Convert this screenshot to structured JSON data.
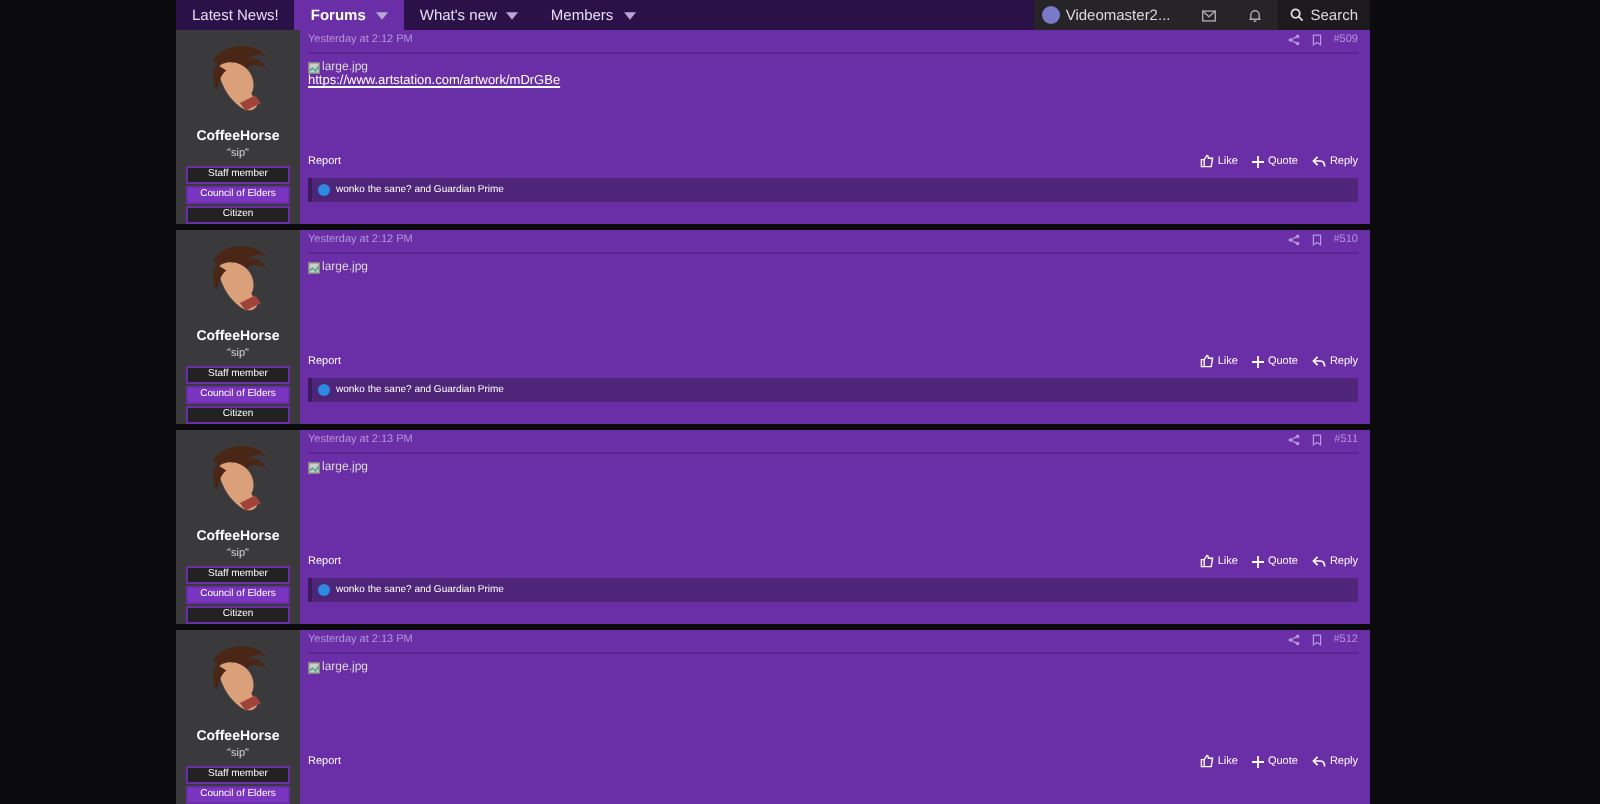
{
  "nav": {
    "tabs": [
      {
        "label": "Latest News!",
        "selected": false,
        "dropdown": false
      },
      {
        "label": "Forums",
        "selected": true,
        "dropdown": true
      },
      {
        "label": "What's new",
        "selected": false,
        "dropdown": true
      },
      {
        "label": "Members",
        "selected": false,
        "dropdown": true
      }
    ],
    "user": {
      "name": "Videomaster2..."
    },
    "search": "Search"
  },
  "posts": [
    {
      "time": "Yesterday at 2:12 PM",
      "number": "#509",
      "author": "CoffeeHorse",
      "title": "\"sip\"",
      "badges": [
        {
          "label": "Staff member",
          "kind": "staff"
        },
        {
          "label": "Council of Elders",
          "kind": "council"
        },
        {
          "label": "Citizen",
          "kind": "plain"
        }
      ],
      "attachment": "large.jpg",
      "link": "https://www.artstation.com/artwork/mDrGBe",
      "report": "Report",
      "actions": [
        {
          "label": "Like",
          "kind": "like"
        },
        {
          "label": "Quote",
          "kind": "quote"
        },
        {
          "label": "Reply",
          "kind": "reply"
        }
      ],
      "reactions": "wonko the sane? and Guardian Prime"
    },
    {
      "time": "Yesterday at 2:12 PM",
      "number": "#510",
      "author": "CoffeeHorse",
      "title": "\"sip\"",
      "badges": [
        {
          "label": "Staff member",
          "kind": "staff"
        },
        {
          "label": "Council of Elders",
          "kind": "council"
        },
        {
          "label": "Citizen",
          "kind": "plain"
        }
      ],
      "attachment": "large.jpg",
      "report": "Report",
      "actions": [
        {
          "label": "Like",
          "kind": "like"
        },
        {
          "label": "Quote",
          "kind": "quote"
        },
        {
          "label": "Reply",
          "kind": "reply"
        }
      ],
      "reactions": "wonko the sane? and Guardian Prime"
    },
    {
      "time": "Yesterday at 2:13 PM",
      "number": "#511",
      "author": "CoffeeHorse",
      "title": "\"sip\"",
      "badges": [
        {
          "label": "Staff member",
          "kind": "staff"
        },
        {
          "label": "Council of Elders",
          "kind": "council"
        },
        {
          "label": "Citizen",
          "kind": "plain"
        }
      ],
      "attachment": "large.jpg",
      "report": "Report",
      "actions": [
        {
          "label": "Like",
          "kind": "like"
        },
        {
          "label": "Quote",
          "kind": "quote"
        },
        {
          "label": "Reply",
          "kind": "reply"
        }
      ],
      "reactions": "wonko the sane? and Guardian Prime"
    },
    {
      "time": "Yesterday at 2:13 PM",
      "number": "#512",
      "author": "CoffeeHorse",
      "title": "\"sip\"",
      "badges": [
        {
          "label": "Staff member",
          "kind": "staff"
        },
        {
          "label": "Council of Elders",
          "kind": "council"
        }
      ],
      "attachment": "large.jpg",
      "report": "Report",
      "actions": [
        {
          "label": "Like",
          "kind": "like"
        },
        {
          "label": "Quote",
          "kind": "quote"
        },
        {
          "label": "Reply",
          "kind": "reply"
        }
      ]
    }
  ]
}
